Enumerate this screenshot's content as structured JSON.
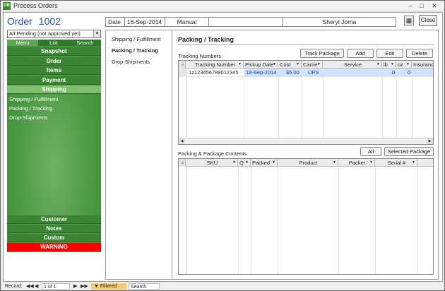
{
  "window": {
    "title": "Process Orders",
    "app_icon": "ms-access-icon",
    "controls": [
      "minimize",
      "maximize",
      "close"
    ]
  },
  "order": {
    "label": "Order",
    "number": "1002"
  },
  "filter": {
    "value": "All Pending (not approved yet)"
  },
  "left_tabs": [
    "Menu",
    "List",
    "Search"
  ],
  "nav": [
    "Snapshot",
    "Order",
    "Items",
    "Payment",
    "Shipping"
  ],
  "shipping_sub": [
    "Shipping / Fulfillment",
    "Packing / Tracking",
    "Drop-Shipments"
  ],
  "nav_bottom": [
    "Customer",
    "Notes",
    "Custom"
  ],
  "warning": "WARNING",
  "infobar": {
    "date_label": "Date",
    "date_value": "16-Sep-2014",
    "mode": "Manual",
    "customer": "Sheryl Jorna"
  },
  "close_label": "Close",
  "subtabs": [
    "Shipping / Fulfillment",
    "Packing / Tracking",
    "Drop-Shipments"
  ],
  "section_title": "Packing / Tracking",
  "tracking": {
    "label": "Tracking Numbers",
    "buttons": [
      "Track Package",
      "Add",
      "Edit",
      "Delete"
    ],
    "columns": [
      "Tracking Number",
      "Pickup Date",
      "Cost",
      "Carrie",
      "Service",
      "lb",
      "oz",
      "Insuranc"
    ],
    "rows": [
      {
        "tracking": "1z123456789012345",
        "pickup": "18-Sep-2014",
        "cost": "$5.00",
        "carrier": "UPS",
        "service": "",
        "lb": "0",
        "oz": "0",
        "insurance": ""
      }
    ]
  },
  "contents": {
    "label": "Packing & Package Contents",
    "buttons": [
      "All",
      "Selected Package"
    ],
    "columns": [
      "SKU",
      "Q",
      "Packed",
      "Product",
      "Packer",
      "Serial #"
    ]
  },
  "statusbar": {
    "record_label": "Record:",
    "record_pos": "1 of 1",
    "filter_state": "Filtered",
    "search_label": "Search"
  },
  "colors": {
    "nav_green": "#3a8433",
    "nav_active": "#7fc071",
    "warning_red": "#ff0000",
    "order_blue": "#27508f",
    "selected_row": "#cfe3ff"
  }
}
